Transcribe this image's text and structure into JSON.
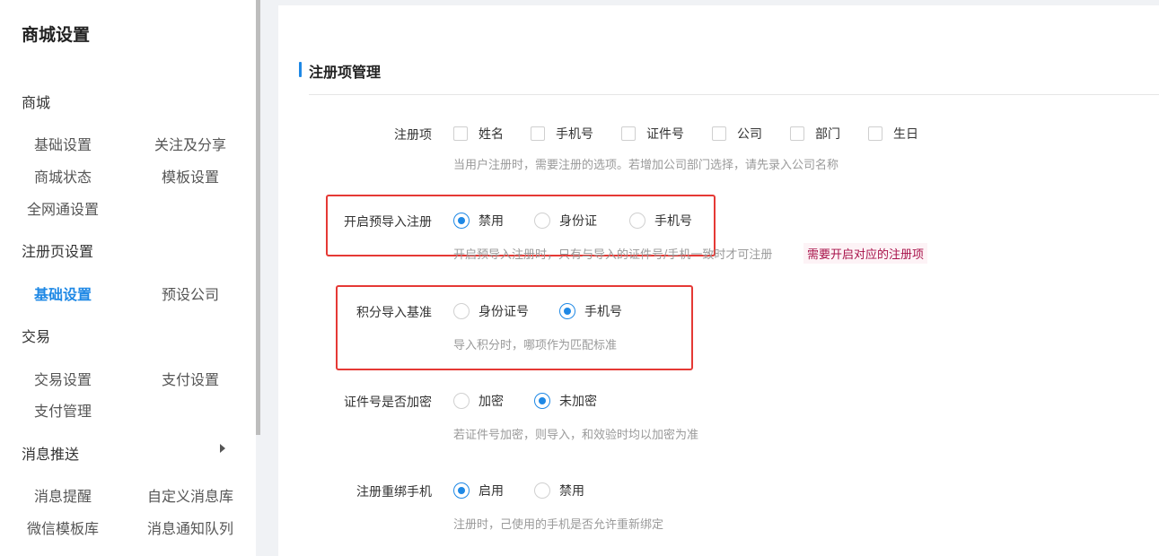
{
  "sidebar": {
    "title": "商城设置",
    "groups": [
      {
        "label": "商城",
        "items": [
          "基础设置",
          "关注及分享",
          "商城状态",
          "模板设置",
          "全网通设置"
        ]
      },
      {
        "label": "注册页设置",
        "items": [
          "基础设置",
          "预设公司"
        ],
        "active_index": 0
      },
      {
        "label": "交易",
        "items": [
          "交易设置",
          "支付设置",
          "支付管理"
        ]
      },
      {
        "label": "消息推送",
        "items": [
          "消息提醒",
          "自定义消息库",
          "微信模板库",
          "消息通知队列"
        ]
      }
    ]
  },
  "main": {
    "section_title": "注册项管理",
    "rows": [
      {
        "label": "注册项",
        "options": [
          "姓名",
          "手机号",
          "证件号",
          "公司",
          "部门",
          "生日"
        ],
        "hint": "当用户注册时，需要注册的选项。若增加公司部门选择，请先录入公司名称"
      },
      {
        "label": "开启预导入注册",
        "options": [
          "禁用",
          "身份证",
          "手机号"
        ],
        "selected": 0,
        "hint": "开启预导入注册时，只有与导入的证件号/手机一致时才可注册",
        "hint_tag": "需要开启对应的注册项"
      },
      {
        "label": "积分导入基准",
        "options": [
          "身份证号",
          "手机号"
        ],
        "selected": 1,
        "hint": "导入积分时，哪项作为匹配标准"
      },
      {
        "label": "证件号是否加密",
        "options": [
          "加密",
          "未加密"
        ],
        "selected": 1,
        "hint": "若证件号加密，则导入，和效验时均以加密为准"
      },
      {
        "label": "注册重绑手机",
        "options": [
          "启用",
          "禁用"
        ],
        "selected": 0,
        "hint": "注册时，己使用的手机是否允许重新绑定"
      }
    ]
  },
  "colors": {
    "accent": "#1e88e5",
    "highlight_box": "#e53935",
    "hint_tag": "#a8124a"
  }
}
